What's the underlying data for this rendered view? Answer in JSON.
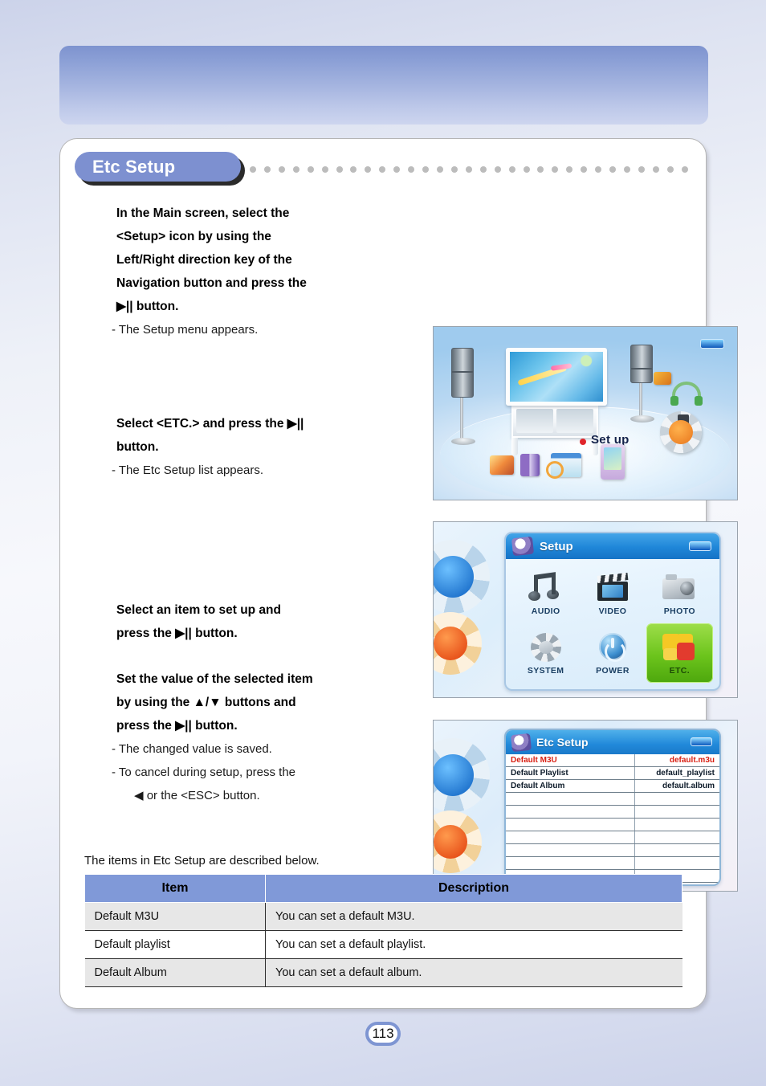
{
  "page": {
    "number": "113",
    "section_title": "Etc Setup"
  },
  "steps": [
    {
      "bold": [
        "In the Main screen, select the",
        "<Setup> icon by using the",
        "Left/Right direction key of the",
        "Navigation button and press the",
        "▶|| button."
      ],
      "notes": [
        "- The Setup menu appears."
      ]
    },
    {
      "bold": [
        "Select <ETC.> and press the ▶||",
        "button."
      ],
      "notes": [
        "- The Etc Setup list appears."
      ]
    },
    {
      "bold": [
        "Select an item to set up and",
        "press the ▶|| button."
      ],
      "notes": []
    },
    {
      "bold": [
        "Set the value of the selected item",
        "by using the ▲/▼ buttons and",
        "press the ▶|| button."
      ],
      "notes": [
        "- The changed value is saved.",
        "- To cancel during setup, press the",
        "◀ or the <ESC> button."
      ]
    }
  ],
  "screenshots": {
    "main_screen": {
      "label": "Set up"
    },
    "setup_menu": {
      "title": "Setup",
      "items": [
        {
          "label": "AUDIO",
          "icon": "music-note-icon",
          "selected": false
        },
        {
          "label": "VIDEO",
          "icon": "clapperboard-icon",
          "selected": false
        },
        {
          "label": "PHOTO",
          "icon": "camera-icon",
          "selected": false
        },
        {
          "label": "SYSTEM",
          "icon": "gear-icon",
          "selected": false
        },
        {
          "label": "POWER",
          "icon": "power-icon",
          "selected": false
        },
        {
          "label": "ETC.",
          "icon": "puzzle-icon",
          "selected": true
        }
      ]
    },
    "etc_setup_list": {
      "title": "Etc Setup",
      "rows": [
        {
          "key": "Default M3U",
          "value": "default.m3u",
          "highlighted": true
        },
        {
          "key": "Default Playlist",
          "value": "default_playlist",
          "highlighted": false
        },
        {
          "key": "Default Album",
          "value": "default.album",
          "highlighted": false
        }
      ],
      "empty_rows": 8
    }
  },
  "table": {
    "intro": "The items in Etc Setup are described below.",
    "headers": {
      "item": "Item",
      "description": "Description"
    },
    "rows": [
      {
        "item": "Default M3U",
        "description": "You can set a default M3U."
      },
      {
        "item": "Default playlist",
        "description": "You can set a default playlist."
      },
      {
        "item": "Default Album",
        "description": "You can set a default album."
      }
    ]
  },
  "colors": {
    "accent": "#7d90d0",
    "table_header": "#8099d8",
    "highlight_red": "#d81f12",
    "selected_green": "#6cc41c"
  }
}
